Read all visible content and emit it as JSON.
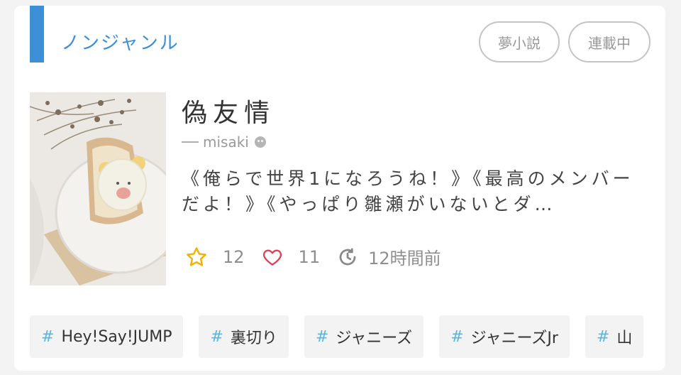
{
  "genre": "ノンジャンル",
  "badges": {
    "dream": "夢小説",
    "serial": "連載中"
  },
  "novel": {
    "title": "偽友情",
    "author": "misaki",
    "summary": "《俺らで世界1になろうね！》《最高のメンバーだよ！》《やっぱり雛瀬がいないとダ…"
  },
  "stats": {
    "stars": "12",
    "likes": "11",
    "updated": "12時間前"
  },
  "tags": [
    "Hey!Say!JUMP",
    "裏切り",
    "ジャニーズ",
    "ジャニーズJr",
    "山"
  ],
  "colors": {
    "accent": "#3d8fd8",
    "star": "#f0b400",
    "heart": "#e0405a",
    "hash": "#5ab6dc"
  },
  "icons": {
    "star": "star-icon",
    "heart": "heart-icon",
    "clock": "clock-icon",
    "author": "smiley-icon"
  }
}
